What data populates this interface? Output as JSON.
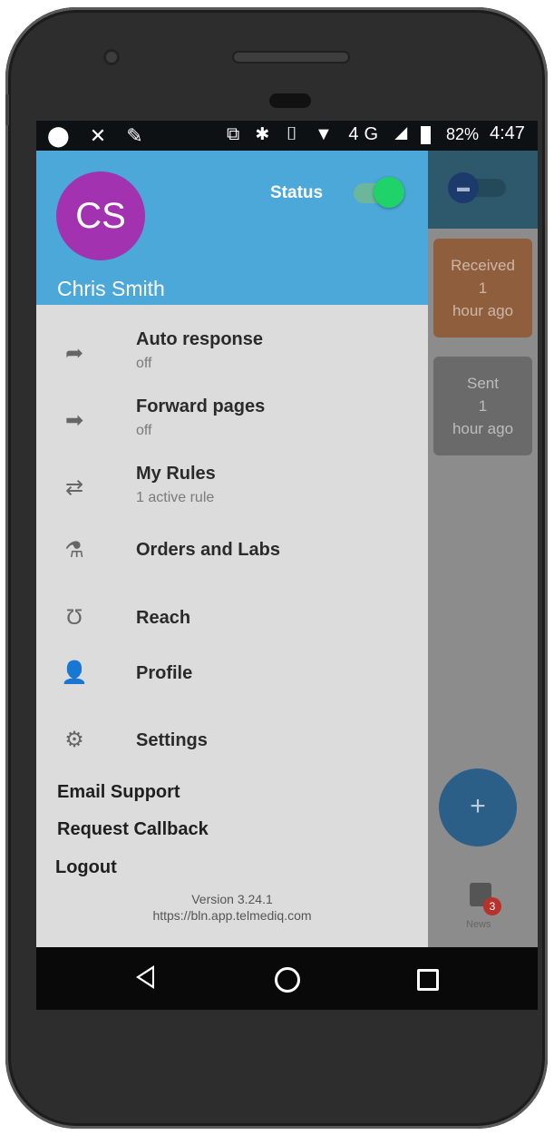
{
  "status_bar": {
    "left_icons": "⬤ ✕ ✎",
    "right_icons": "⧉ ✱ ▯ ▼ 4G ◢",
    "battery": "82%",
    "time": "4:47"
  },
  "drawer": {
    "avatar_initials": "CS",
    "status_label": "Status",
    "status_on": true,
    "user_name": "Chris Smith",
    "items": [
      {
        "icon": "reply-icon",
        "glyph": "➦",
        "title": "Auto response",
        "subtitle": "off"
      },
      {
        "icon": "forward-arrow-icon",
        "glyph": "➡",
        "title": "Forward pages",
        "subtitle": "off"
      },
      {
        "icon": "swap-arrows-icon",
        "glyph": "⇄",
        "title": "My Rules",
        "subtitle": "1 active rule"
      },
      {
        "icon": "flask-icon",
        "glyph": "⚗",
        "title": "Orders and Labs",
        "subtitle": ""
      },
      {
        "icon": "stethoscope-icon",
        "glyph": "Ʊ",
        "title": "Reach",
        "subtitle": ""
      },
      {
        "icon": "person-icon",
        "glyph": "👤",
        "title": "Profile",
        "subtitle": ""
      },
      {
        "icon": "gear-icon",
        "glyph": "⚙",
        "title": "Settings",
        "subtitle": ""
      }
    ],
    "links": [
      "Email Support",
      "Request Callback",
      "Logout"
    ],
    "version": "Version 3.24.1",
    "url": "https://bln.app.telmediq.com"
  },
  "background_app": {
    "received": {
      "label": "Received",
      "count": "1",
      "time": "hour ago"
    },
    "sent": {
      "label": "Sent",
      "count": "1",
      "time": "hour ago"
    },
    "fab_label": "+",
    "news_badge": "3",
    "news_label": "News"
  },
  "colors": {
    "drawer_header": "#4ba8d8",
    "avatar": "#a232b0",
    "status_switch_on": "#1fd26a",
    "received_card": "#8f5e3d",
    "fab": "#2b5f88"
  }
}
